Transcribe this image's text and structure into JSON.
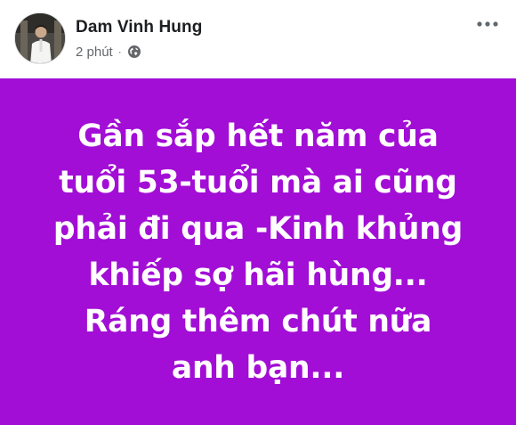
{
  "post": {
    "author": {
      "name": "Dam Vinh Hung",
      "avatar_icon": "profile-photo"
    },
    "timestamp": "2 phút",
    "separator": "·",
    "privacy_icon": "globe-icon",
    "more_icon": "more-options-icon",
    "status": {
      "background_color": "#a20ed5",
      "text_color": "#ffffff",
      "lines": [
        "Gần sắp hết năm của",
        "tuổi 53-tuổi mà ai cũng",
        "phải đi qua -Kinh khủng",
        "khiếp sợ hãi hùng...",
        "Ráng thêm chút nữa",
        "anh bạn..."
      ]
    }
  }
}
